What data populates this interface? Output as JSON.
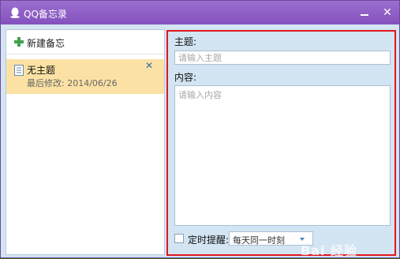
{
  "window": {
    "title": "QQ备忘录"
  },
  "sidebar": {
    "new_note_label": "新建备忘",
    "notes": [
      {
        "title": "无主题",
        "modified": "最后修改: 2014/06/26"
      }
    ]
  },
  "editor": {
    "subject_label": "主题:",
    "subject_placeholder": "请输入主题",
    "content_label": "内容:",
    "content_placeholder": "请输入内容",
    "reminder_label": "定时提醒:",
    "reminder_value": "每天同一时刻",
    "reminder_checked": false
  },
  "watermark": "Bai 经验",
  "colors": {
    "titlebar": "#8451bd",
    "panel": "#d3e4f2",
    "selected_note": "#fbe2a4",
    "highlight_border": "#e0161e"
  }
}
